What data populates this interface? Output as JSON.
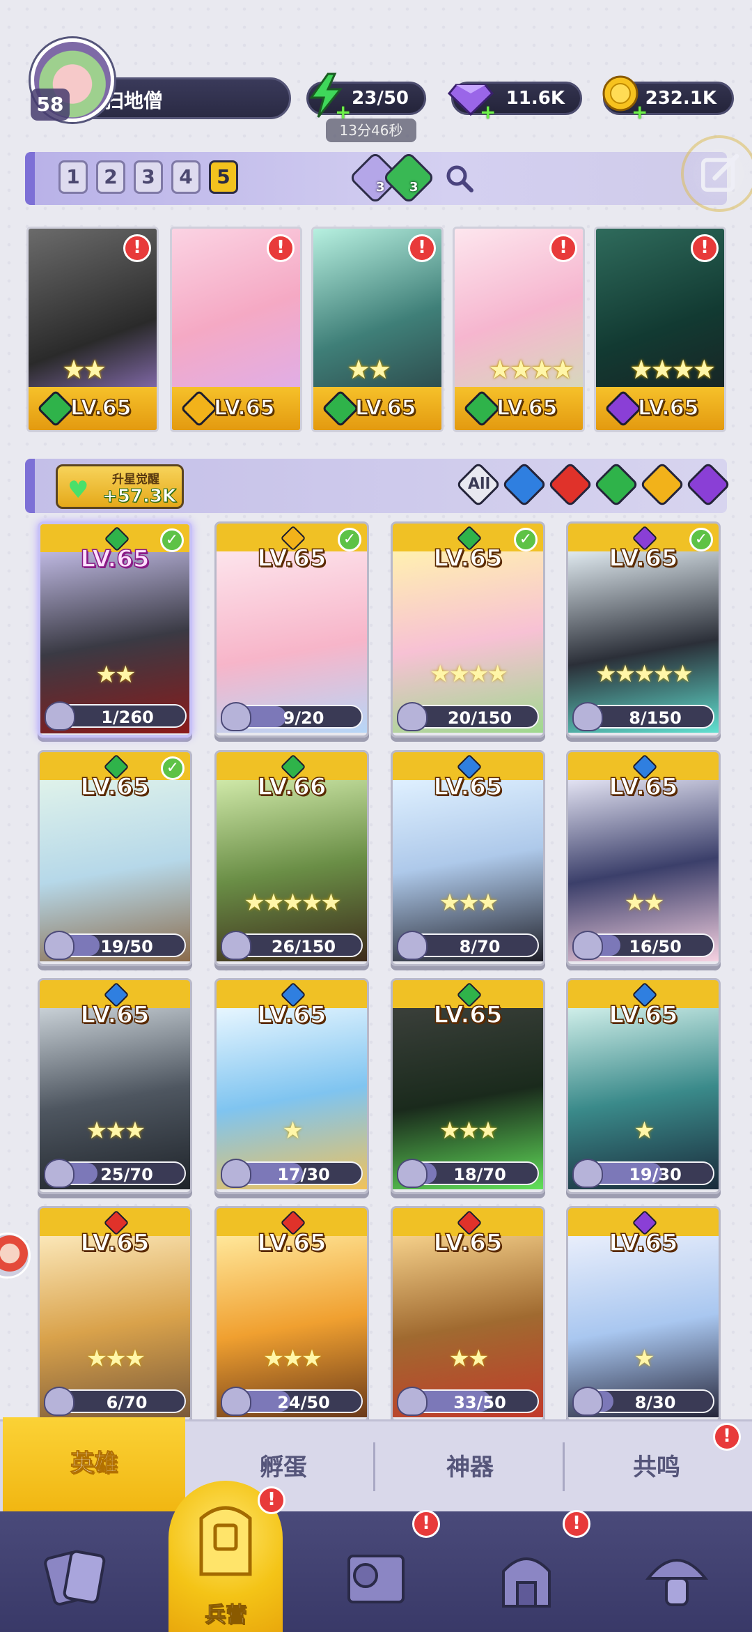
{
  "player": {
    "level": "58",
    "name": "扫地僧"
  },
  "resources": {
    "energy": "23/50",
    "gems": "11.6K",
    "gold": "232.1K",
    "energy_timer": "13分46秒"
  },
  "teams": {
    "tabs": [
      "1",
      "2",
      "3",
      "4",
      "5"
    ],
    "active": "5"
  },
  "team_chips": [
    {
      "count": "3"
    },
    {
      "count": "3"
    }
  ],
  "lineup": [
    {
      "level": "LV.65",
      "element": "nature",
      "stars": "★★",
      "alert": "!"
    },
    {
      "level": "LV.65",
      "element": "light",
      "stars": "",
      "alert": "!"
    },
    {
      "level": "LV.65",
      "element": "nature",
      "stars": "★★",
      "alert": "!"
    },
    {
      "level": "LV.65",
      "element": "nature",
      "stars": "★★★★",
      "alert": "!"
    },
    {
      "level": "LV.65",
      "element": "dark",
      "stars": "★★★★",
      "alert": "!"
    }
  ],
  "awaken": {
    "title": "升星觉醒",
    "value": "+57.3K"
  },
  "filters": {
    "all_label": "All",
    "elements": [
      "water",
      "fire",
      "nature",
      "light",
      "dark"
    ]
  },
  "colors": {
    "nature": "#2fb34a",
    "light": "#f2b21a",
    "dark": "#8a3fd6",
    "water": "#2f7fe0",
    "fire": "#e0322a",
    "all": "#e8e8f0"
  },
  "heroes": [
    {
      "level": "LV.65",
      "element": "nature",
      "shards": "1/260",
      "fill": 0.004,
      "stars": "★★",
      "checked": true,
      "special": true
    },
    {
      "level": "LV.65",
      "element": "light",
      "shards": "9/20",
      "fill": 0.45,
      "stars": "",
      "checked": true
    },
    {
      "level": "LV.65",
      "element": "nature",
      "shards": "20/150",
      "fill": 0.13,
      "stars": "★★★★",
      "checked": true
    },
    {
      "level": "LV.65",
      "element": "dark",
      "shards": "8/150",
      "fill": 0.05,
      "stars": "★★★★★",
      "checked": true
    },
    {
      "level": "LV.65",
      "element": "nature",
      "shards": "19/50",
      "fill": 0.38,
      "stars": "",
      "checked": true
    },
    {
      "level": "LV.66",
      "element": "nature",
      "shards": "26/150",
      "fill": 0.17,
      "stars": "★★★★★",
      "checked": false
    },
    {
      "level": "LV.65",
      "element": "water",
      "shards": "8/70",
      "fill": 0.11,
      "stars": "★★★",
      "checked": false
    },
    {
      "level": "LV.65",
      "element": "water",
      "shards": "16/50",
      "fill": 0.32,
      "stars": "★★",
      "checked": false
    },
    {
      "level": "LV.65",
      "element": "water",
      "shards": "25/70",
      "fill": 0.36,
      "stars": "★★★",
      "checked": false
    },
    {
      "level": "LV.65",
      "element": "water",
      "shards": "17/30",
      "fill": 0.57,
      "stars": "★",
      "checked": false
    },
    {
      "level": "LV.65",
      "element": "nature",
      "shards": "18/70",
      "fill": 0.26,
      "stars": "★★★",
      "checked": false
    },
    {
      "level": "LV.65",
      "element": "water",
      "shards": "19/30",
      "fill": 0.63,
      "stars": "★",
      "checked": false
    },
    {
      "level": "LV.65",
      "element": "fire",
      "shards": "6/70",
      "fill": 0.09,
      "stars": "★★★",
      "checked": false
    },
    {
      "level": "LV.65",
      "element": "fire",
      "shards": "24/50",
      "fill": 0.48,
      "stars": "★★★",
      "checked": false
    },
    {
      "level": "LV.65",
      "element": "fire",
      "shards": "33/50",
      "fill": 0.66,
      "stars": "★★",
      "checked": false
    },
    {
      "level": "LV.65",
      "element": "dark",
      "shards": "8/30",
      "fill": 0.27,
      "stars": "★",
      "checked": false
    }
  ],
  "subtabs": [
    {
      "label": "英雄",
      "active": true
    },
    {
      "label": "孵蛋",
      "active": false
    },
    {
      "label": "神器",
      "active": false
    },
    {
      "label": "共鸣",
      "active": false,
      "alert": "!"
    }
  ],
  "nav": {
    "items": [
      {
        "icon": "cards-icon",
        "label": "",
        "alert": ""
      },
      {
        "icon": "barracks-icon",
        "label": "兵营",
        "alert": "!"
      },
      {
        "icon": "map-icon",
        "label": "",
        "alert": "!"
      },
      {
        "icon": "shop-icon",
        "label": "",
        "alert": "!"
      },
      {
        "icon": "mushroom-icon",
        "label": "",
        "alert": ""
      }
    ]
  }
}
